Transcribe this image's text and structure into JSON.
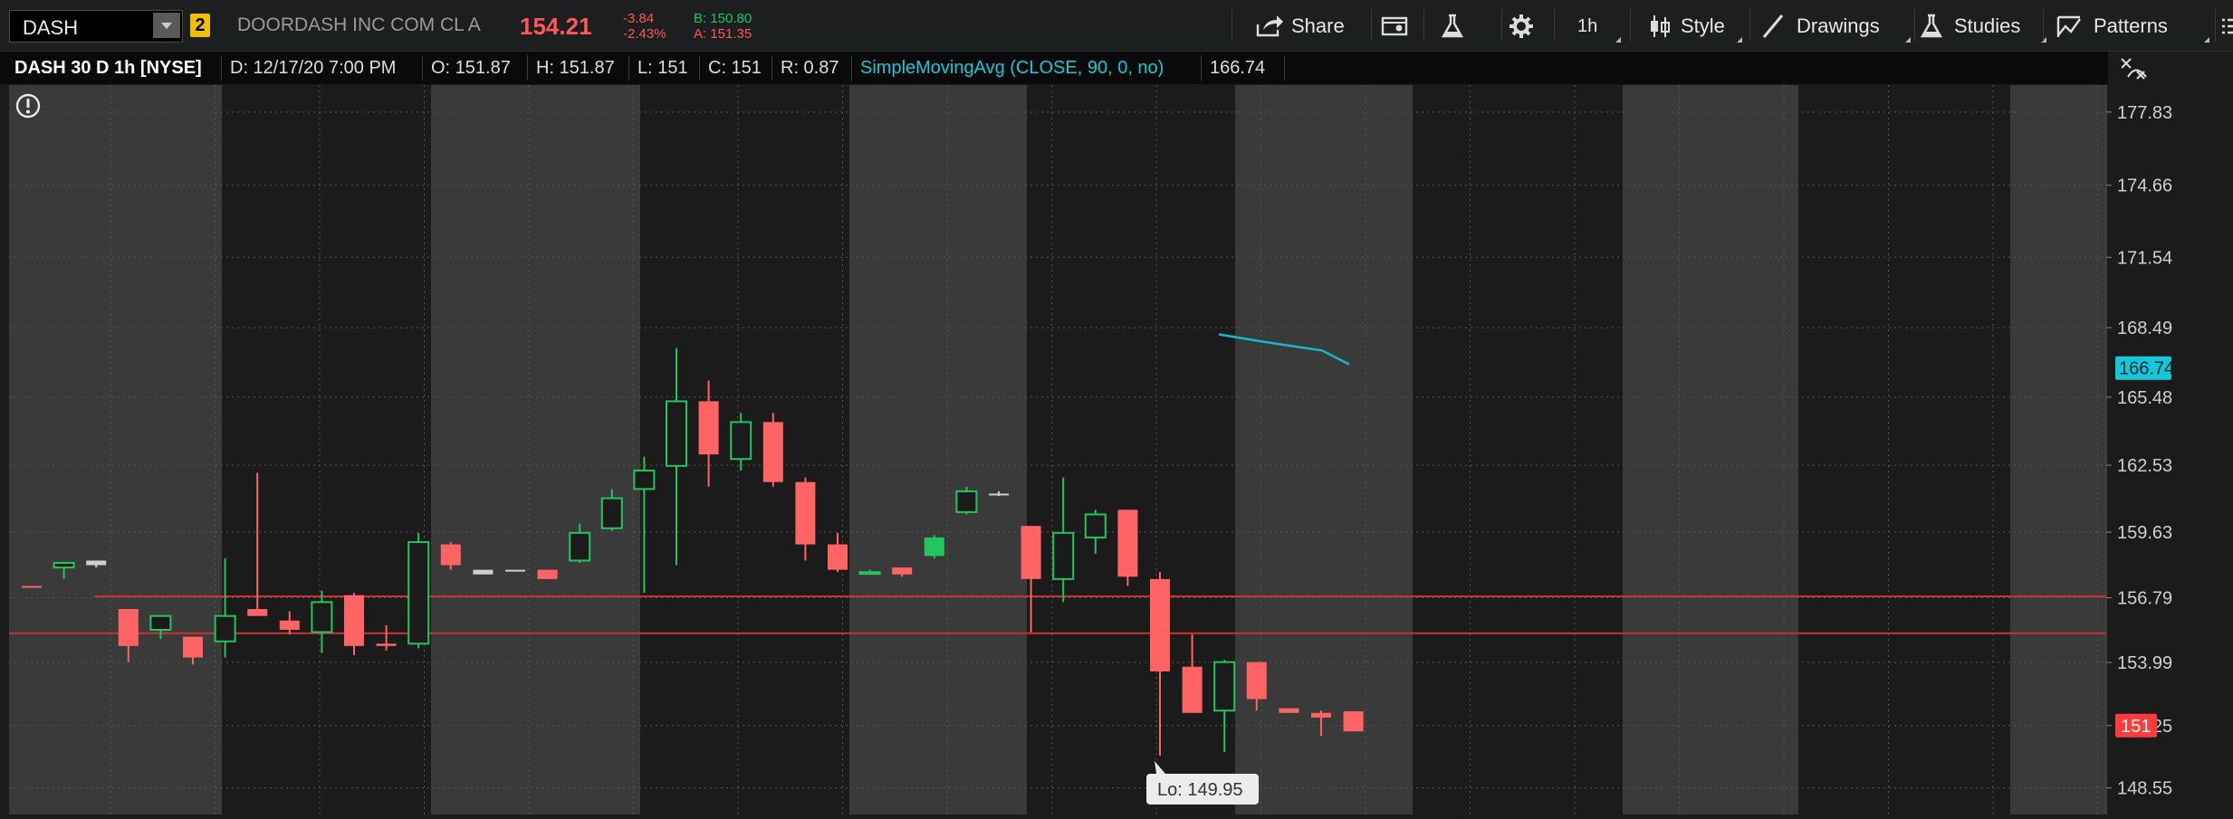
{
  "toolbar": {
    "symbol": "DASH",
    "badge": "2",
    "company": "DOORDASH INC COM CL A",
    "last_price": "154.21",
    "change": "-3.84",
    "change_pct": "-2.43%",
    "bid": "B: 150.80",
    "ask": "A: 151.35",
    "share_label": "Share",
    "timeframe_label": "1h",
    "style_label": "Style",
    "drawings_label": "Drawings",
    "studies_label": "Studies",
    "patterns_label": "Patterns"
  },
  "infobar": {
    "title": "DASH 30 D 1h [NYSE]",
    "date": "D: 12/17/20 7:00 PM",
    "open": "O: 151.87",
    "high": "H: 151.87",
    "low": "L: 151",
    "close": "C: 151",
    "range": "R: 0.87",
    "study": "SimpleMovingAvg (CLOSE, 90, 0, no)",
    "study_value": "166.74"
  },
  "chart_data": {
    "type": "candlestick",
    "y_axis": {
      "ticks": [
        177.83,
        174.66,
        171.54,
        168.49,
        165.48,
        162.53,
        159.63,
        156.79,
        153.99,
        151.25,
        148.55
      ],
      "range": [
        147.4,
        179.0
      ]
    },
    "sma_label": "166.74",
    "sma_line": [
      168.2,
      167.85,
      167.5,
      166.9
    ],
    "last_label": "151",
    "low_marker": "Lo: 149.95",
    "horizontal_lines": [
      156.85,
      155.25
    ],
    "colors": {
      "up": "#22c55e",
      "down": "#ff6464",
      "flat": "#cfcfcf",
      "sma": "#14b8c8",
      "hline": "#d03030"
    },
    "candles": [
      {
        "o": 157.3,
        "h": 157.3,
        "l": 157.3,
        "c": 157.3,
        "t": "down"
      },
      {
        "o": 158.1,
        "h": 158.1,
        "l": 157.6,
        "c": 158.3,
        "t": "up"
      },
      {
        "o": 158.2,
        "h": 158.3,
        "l": 158.1,
        "c": 158.4,
        "t": "flat"
      },
      {
        "o": 156.3,
        "h": 156.3,
        "l": 154.0,
        "c": 154.7,
        "t": "down"
      },
      {
        "o": 155.4,
        "h": 155.6,
        "l": 155.0,
        "c": 156.0,
        "t": "up"
      },
      {
        "o": 155.1,
        "h": 155.1,
        "l": 153.9,
        "c": 154.2,
        "t": "down"
      },
      {
        "o": 154.9,
        "h": 158.5,
        "l": 154.2,
        "c": 156.0,
        "t": "up"
      },
      {
        "o": 156.3,
        "h": 162.2,
        "l": 156.2,
        "c": 156.0,
        "t": "down"
      },
      {
        "o": 155.8,
        "h": 156.2,
        "l": 155.2,
        "c": 155.4,
        "t": "down"
      },
      {
        "o": 155.3,
        "h": 157.1,
        "l": 154.4,
        "c": 156.6,
        "t": "up"
      },
      {
        "o": 156.9,
        "h": 157.0,
        "l": 154.3,
        "c": 154.7,
        "t": "down"
      },
      {
        "o": 154.8,
        "h": 155.6,
        "l": 154.5,
        "c": 154.7,
        "t": "down"
      },
      {
        "o": 154.8,
        "h": 159.6,
        "l": 154.6,
        "c": 159.2,
        "t": "up"
      },
      {
        "o": 159.1,
        "h": 159.2,
        "l": 158.0,
        "c": 158.2,
        "t": "down"
      },
      {
        "o": 158.0,
        "h": 158.0,
        "l": 158.0,
        "c": 157.8,
        "t": "flat"
      },
      {
        "o": 158.0,
        "h": 158.0,
        "l": 158.0,
        "c": 158.0,
        "t": "flat"
      },
      {
        "o": 158.0,
        "h": 158.0,
        "l": 157.6,
        "c": 157.6,
        "t": "down"
      },
      {
        "o": 158.4,
        "h": 160.0,
        "l": 158.3,
        "c": 159.6,
        "t": "up"
      },
      {
        "o": 159.8,
        "h": 161.5,
        "l": 159.7,
        "c": 161.1,
        "t": "up"
      },
      {
        "o": 161.5,
        "h": 162.9,
        "l": 157.0,
        "c": 162.3,
        "t": "up"
      },
      {
        "o": 162.5,
        "h": 167.6,
        "l": 158.2,
        "c": 165.3,
        "t": "up"
      },
      {
        "o": 165.3,
        "h": 166.2,
        "l": 161.6,
        "c": 163.0,
        "t": "down"
      },
      {
        "o": 162.8,
        "h": 164.8,
        "l": 162.3,
        "c": 164.4,
        "t": "up"
      },
      {
        "o": 164.4,
        "h": 164.8,
        "l": 161.6,
        "c": 161.8,
        "t": "down"
      },
      {
        "o": 161.8,
        "h": 162.0,
        "l": 158.4,
        "c": 159.1,
        "t": "down"
      },
      {
        "o": 159.1,
        "h": 159.6,
        "l": 157.9,
        "c": 158.0,
        "t": "down"
      },
      {
        "o": 157.9,
        "h": 158.0,
        "l": 157.8,
        "c": 157.9,
        "t": "up"
      },
      {
        "o": 158.1,
        "h": 158.1,
        "l": 157.7,
        "c": 157.8,
        "t": "down"
      },
      {
        "o": 158.6,
        "h": 159.5,
        "l": 158.5,
        "c": 159.4,
        "t": "up"
      },
      {
        "o": 160.5,
        "h": 161.6,
        "l": 160.4,
        "c": 161.4,
        "t": "up"
      },
      {
        "o": 161.3,
        "h": 161.4,
        "l": 161.2,
        "c": 161.3,
        "t": "flat"
      },
      {
        "o": 159.9,
        "h": 159.9,
        "l": 155.3,
        "c": 157.6,
        "t": "down"
      },
      {
        "o": 157.6,
        "h": 162.0,
        "l": 156.6,
        "c": 159.6,
        "t": "up"
      },
      {
        "o": 159.4,
        "h": 160.6,
        "l": 158.7,
        "c": 160.4,
        "t": "up"
      },
      {
        "o": 160.6,
        "h": 160.6,
        "l": 157.3,
        "c": 157.7,
        "t": "down"
      },
      {
        "o": 157.6,
        "h": 157.9,
        "l": 149.95,
        "c": 153.6,
        "t": "down"
      },
      {
        "o": 153.8,
        "h": 155.2,
        "l": 152.0,
        "c": 151.8,
        "t": "down"
      },
      {
        "o": 151.9,
        "h": 154.1,
        "l": 150.1,
        "c": 154.0,
        "t": "up"
      },
      {
        "o": 154.0,
        "h": 154.0,
        "l": 151.9,
        "c": 152.4,
        "t": "down"
      },
      {
        "o": 152.0,
        "h": 152.0,
        "l": 151.8,
        "c": 151.8,
        "t": "down"
      },
      {
        "o": 151.8,
        "h": 151.9,
        "l": 150.8,
        "c": 151.6,
        "t": "down"
      },
      {
        "o": 151.87,
        "h": 151.87,
        "l": 151.0,
        "c": 151.0,
        "t": "down"
      }
    ]
  }
}
